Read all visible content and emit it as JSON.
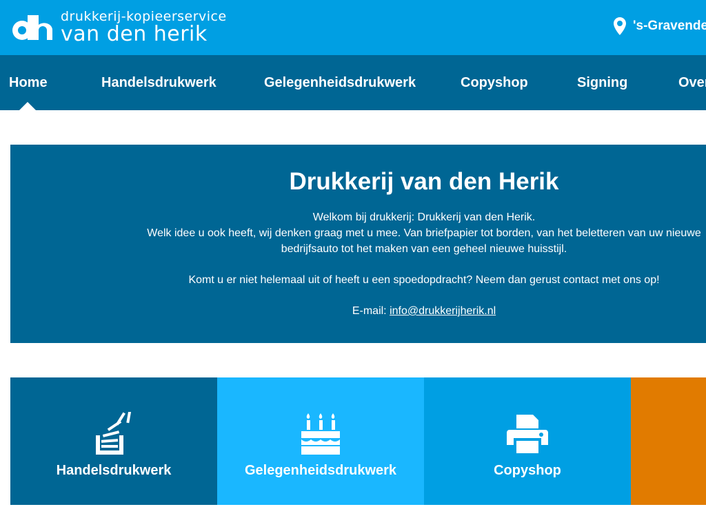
{
  "header": {
    "logo_line1": "drukkerij-kopieerservice",
    "logo_line2": "van den herik",
    "location": "'s-Gravendeel"
  },
  "nav": {
    "items": [
      "Home",
      "Handelsdrukwerk",
      "Gelegenheidsdrukwerk",
      "Copyshop",
      "Signing",
      "Over ons"
    ],
    "active": "Home"
  },
  "hero": {
    "title": "Drukkerij van den Herik",
    "line1": "Welkom bij drukkerij: Drukkerij van den Herik.",
    "line2": "Welk idee u ook heeft, wij denken graag met u mee. Van briefpapier tot borden, van het beletteren van uw nieuwe bedrijfsauto tot het maken van een geheel nieuwe huisstijl.",
    "line3": "Komt u er niet helemaal uit of heeft u een spoedopdracht? Neem dan gerust contact met ons op!",
    "email_label": "E-mail: ",
    "email": "info@drukkerijherik.nl"
  },
  "tiles": [
    {
      "label": "Handelsdrukwerk",
      "icon": "paper-stack-icon",
      "color": "#006694"
    },
    {
      "label": "Gelegenheidsdrukwerk",
      "icon": "birthday-cake-icon",
      "color": "#1ab7ff"
    },
    {
      "label": "Copyshop",
      "icon": "printer-icon",
      "color": "#009fe3"
    },
    {
      "label": "",
      "icon": "",
      "color": "#e17b00"
    }
  ],
  "colors": {
    "topbar": "#009fe3",
    "nav": "#006694",
    "hero": "#006694"
  }
}
